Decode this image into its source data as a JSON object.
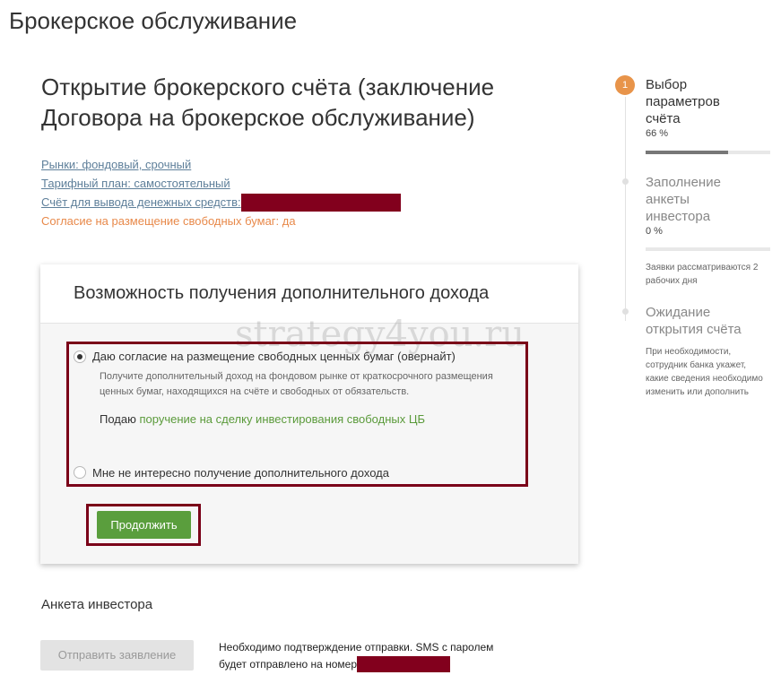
{
  "header": {
    "title": "Брокерское обслуживание"
  },
  "main": {
    "title": "Открытие брокерского счёта (заключение Договора на брокерское обслуживание)",
    "params": {
      "markets": "Рынки: фондовый, срочный",
      "tariff": "Тарифный план: самостоятельный",
      "withdraw_account": "Счёт для вывода денежных средств:",
      "consent": "Согласие на размещение свободных бумаг: да"
    }
  },
  "card": {
    "title": "Возможность получения дополнительного дохода",
    "option_yes": {
      "label": "Даю согласие на размещение свободных ценных бумаг (овернайт)",
      "description": "Получите дополнительный доход на фондовом рынке от краткосрочного размещения ценных бумаг, находящихся на счёте и свободных от обязательств.",
      "submit_prefix": "Подаю",
      "submit_link": "поручение на сделку инвестирования свободных ЦБ"
    },
    "option_no": {
      "label": "Мне не интересно получение дополнительного дохода"
    },
    "continue_button": "Продолжить"
  },
  "investor": {
    "title": "Анкета инвестора",
    "send_button": "Отправить заявление",
    "sms_line1": "Необходимо подтверждение отправки. SMS с паролем",
    "sms_line2": "будет отправлено на номер"
  },
  "steps": [
    {
      "number": "1",
      "title": "Выбор параметров счёта",
      "percent": "66 %",
      "progress": 0.66
    },
    {
      "title": "Заполнение анкеты инвестора",
      "percent": "0 %",
      "progress": 0,
      "note": "Заявки рассматриваются 2 рабочих дня"
    },
    {
      "title": "Ожидание открытия счёта",
      "note": "При необходимости, сотрудник банка укажет, какие сведения необходимо изменить или дополнить"
    }
  ],
  "watermark": "strategy4you.ru",
  "colors": {
    "accent_green": "#5a9e3d",
    "step_orange": "#e8944a",
    "highlight_box": "#7a0018",
    "consent_orange": "#e8894a"
  }
}
